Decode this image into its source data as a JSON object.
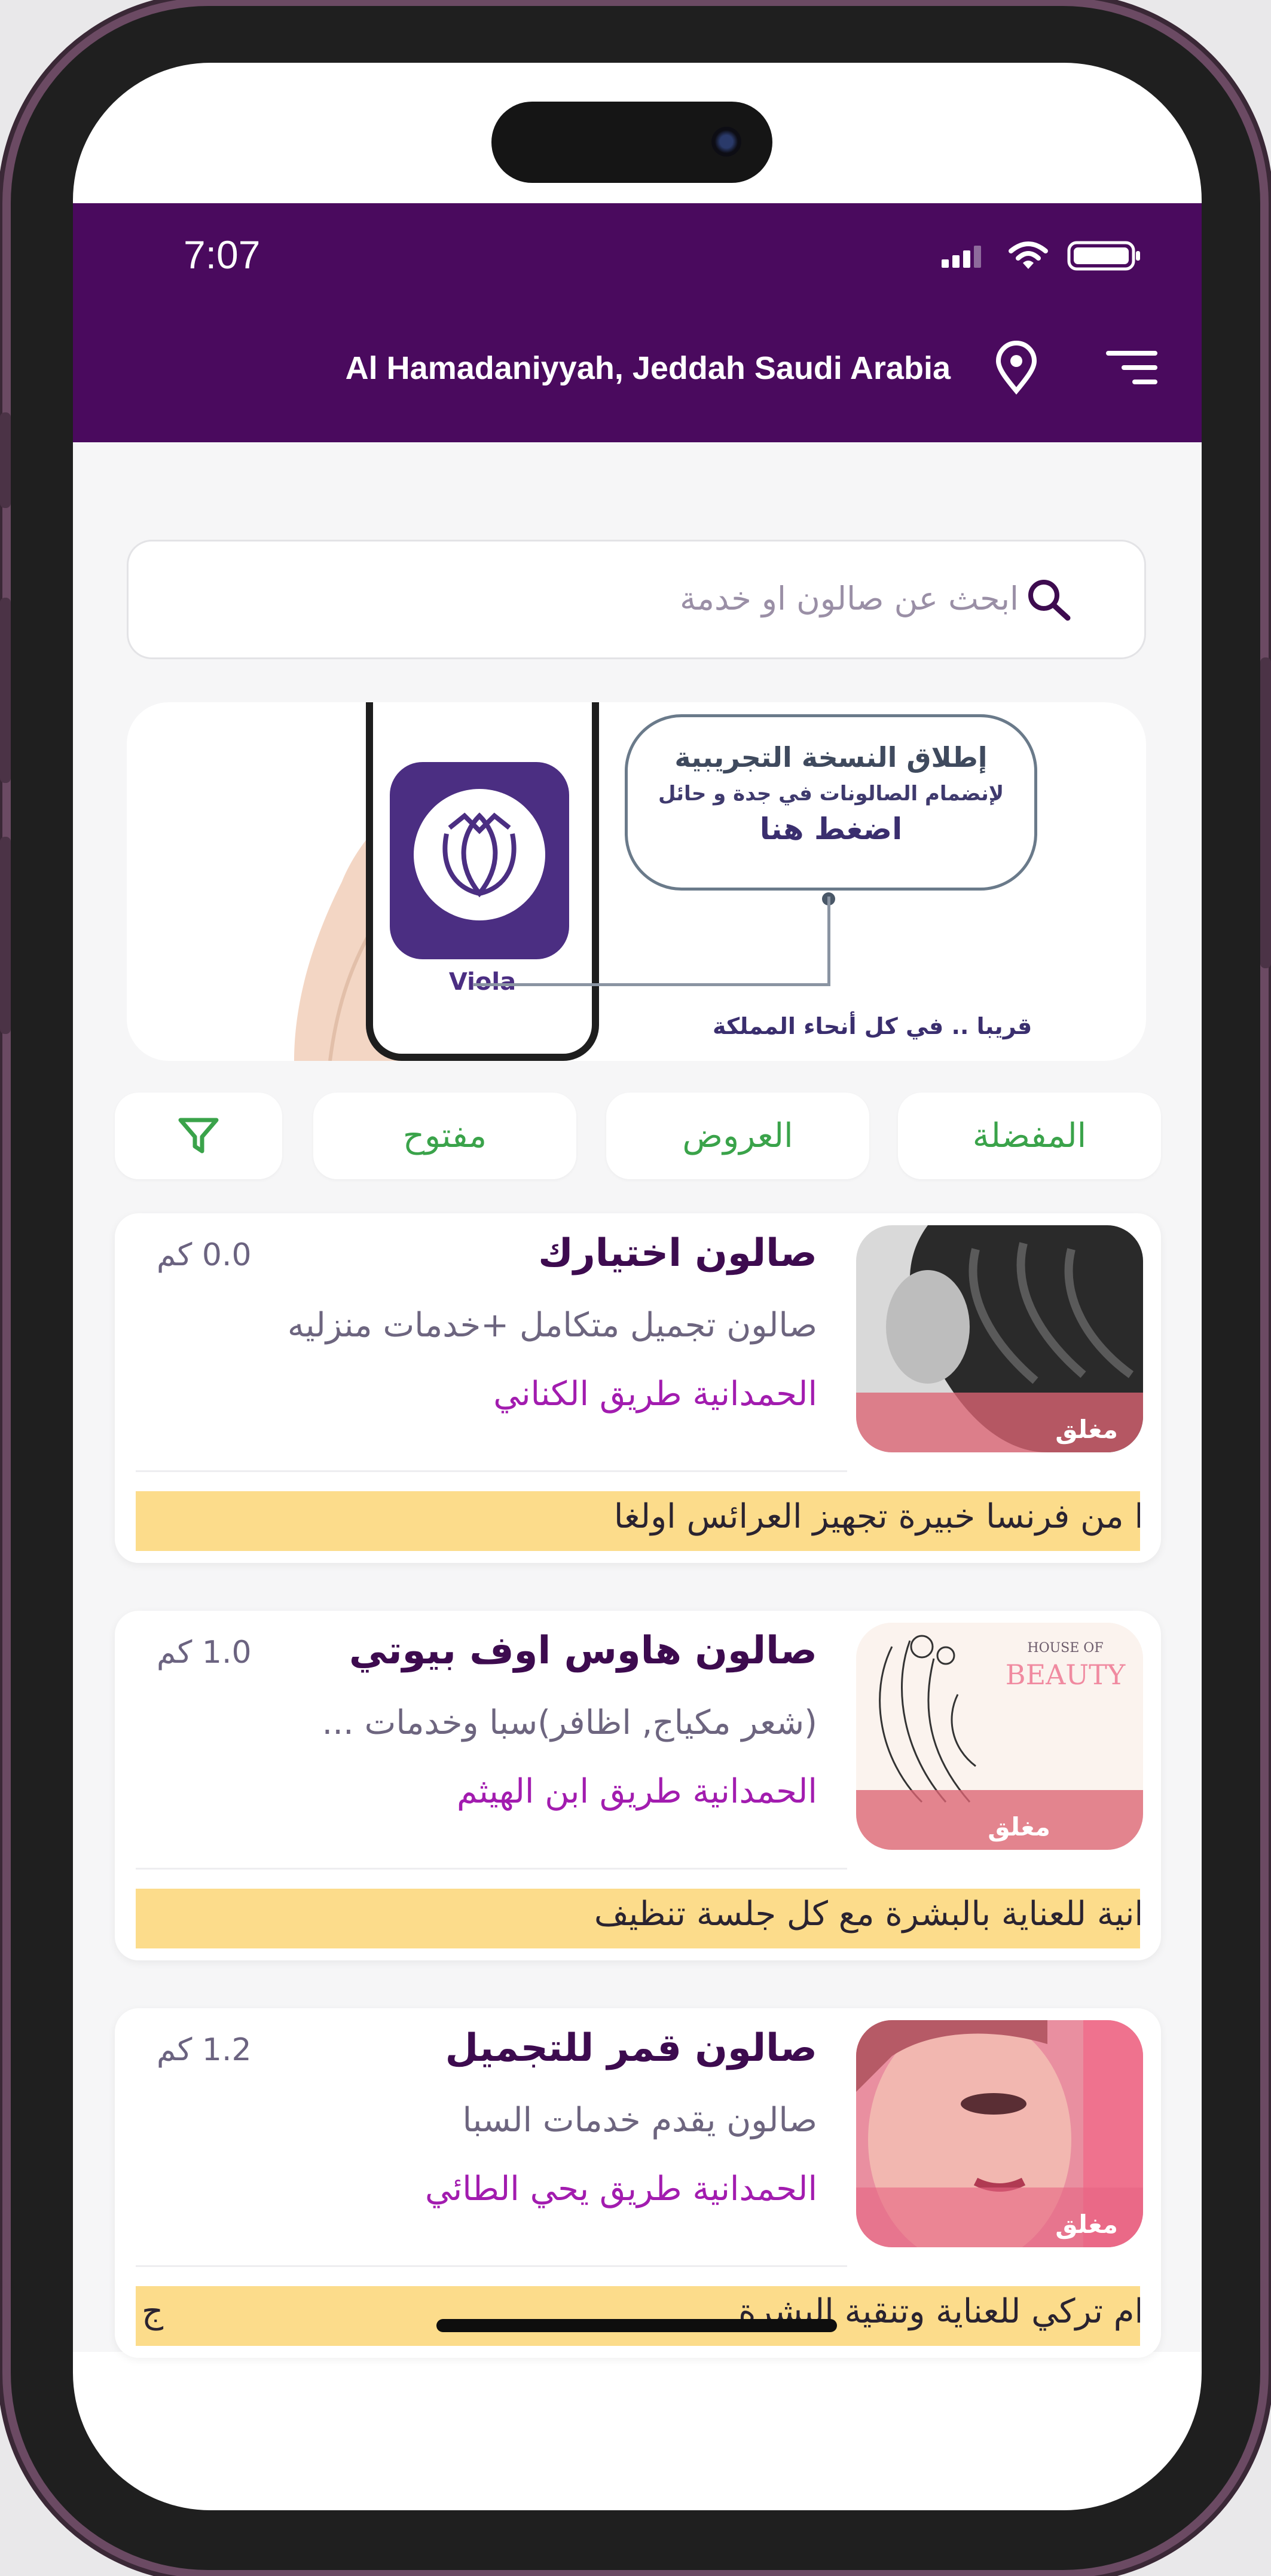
{
  "status_bar": {
    "time": "7:07"
  },
  "header": {
    "location": "Al Hamadaniyyah, Jeddah Saudi Arabia"
  },
  "search": {
    "placeholder": "ابحث عن صالون او خدمة"
  },
  "banner": {
    "line1": "إطلاق النسخة التجريبية",
    "line2": "لإنضمام الصالونات في جدة و حائل",
    "cta": "اضغط هنا",
    "footer": "قريبا .. في كل أنحاء المملكة",
    "app_name": "Viola"
  },
  "filters": {
    "favorites": "المفضلة",
    "offers": "العروض",
    "open": "مفتوح",
    "filter_icon": "filter-icon"
  },
  "colors": {
    "header": "#4a0a5e",
    "accent_green": "#3aa34a",
    "address": "#a21caf",
    "promo_bg": "#fcdc8b",
    "closed_band": "#dc6473"
  },
  "salons": [
    {
      "name": "صالون اختيارك",
      "distance": "0.0 كم",
      "description": "صالون تجميل متكامل +خدمات منزليه",
      "address": "الحمدانية طريق الكناني",
      "status": "مغلق",
      "promo": "ا من فرنسا خبيرة تجهيز العرائس اولغا"
    },
    {
      "name": "صالون هاوس اوف بيوتي",
      "distance": "1.0 كم",
      "description": "(شعر مكياج, اظافر)سبا وخدمات ...",
      "address": "الحمدانية طريق ابن الهيثم",
      "status": "مغلق",
      "logo_line1": "HOUSE OF",
      "logo_line2": "BEAUTY",
      "promo": "انية للعناية بالبشرة مع كل جلسة تنظيف"
    },
    {
      "name": "صالون قمر للتجميل",
      "distance": "1.2 كم",
      "description": "صالون يقدم خدمات السبا",
      "address": "الحمدانية طريق يحي الطائي",
      "status": "مغلق",
      "promo": "ام تركي للعناية وتنقية البشرة",
      "promo_tail": "ج"
    }
  ]
}
